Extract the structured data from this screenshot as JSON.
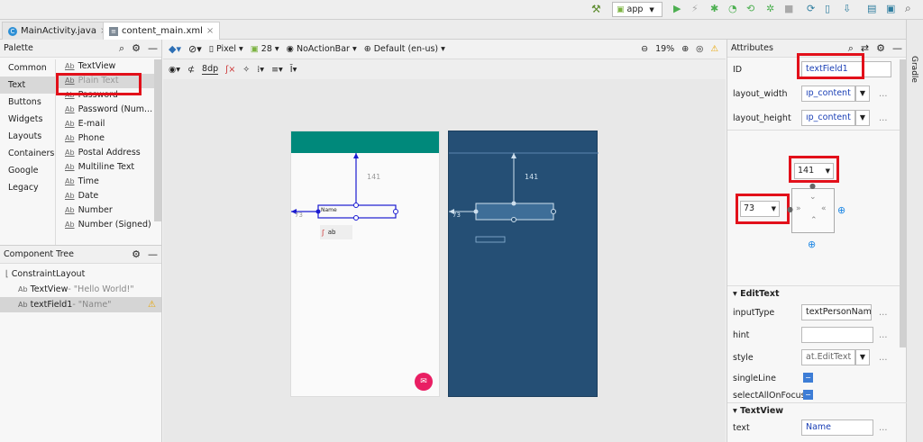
{
  "toolbar": {
    "run_config": "app"
  },
  "tabs": [
    {
      "label": "MainActivity.java",
      "icon": "java-class-icon"
    },
    {
      "label": "content_main.xml",
      "icon": "layout-file-icon"
    }
  ],
  "gradle_label": "Gradle",
  "palette": {
    "title": "Palette",
    "categories": [
      "Common",
      "Text",
      "Buttons",
      "Widgets",
      "Layouts",
      "Containers",
      "Google",
      "Legacy"
    ],
    "selected_category": "Text",
    "items": [
      "TextView",
      "Plain Text",
      "Password",
      "Password (Num...",
      "E-mail",
      "Phone",
      "Postal Address",
      "Multiline Text",
      "Time",
      "Date",
      "Number",
      "Number (Signed)"
    ]
  },
  "component_tree": {
    "title": "Component Tree",
    "root": "ConstraintLayout",
    "children": [
      {
        "name": "TextView",
        "detail": "- \"Hello World!\""
      },
      {
        "name": "textField1",
        "detail": "- \"Name\""
      }
    ]
  },
  "editor_toolbar": {
    "device": "Pixel",
    "api": "28",
    "theme": "NoActionBar",
    "locale": "Default (en-us)",
    "zoom": "19%",
    "margin": "8dp"
  },
  "design": {
    "top_margin": "141",
    "left_margin": "73",
    "field_text": "Name"
  },
  "attributes": {
    "title": "Attributes",
    "id_label": "ID",
    "id_value": "textField1",
    "layout_width_label": "layout_width",
    "layout_width_value": "ıp_content",
    "layout_height_label": "layout_height",
    "layout_height_value": "ıp_content",
    "top_margin": "141",
    "left_margin": "73",
    "edittext_section": "EditText",
    "input_type_label": "inputType",
    "input_type_value": "textPersonName",
    "hint_label": "hint",
    "hint_value": "",
    "style_label": "style",
    "style_value": "at.EditText",
    "single_line_label": "singleLine",
    "select_all_label": "selectAllOnFocus",
    "textview_section": "TextView",
    "text_label": "text",
    "text_value": "Name"
  },
  "colors": {
    "teal": "#00897b",
    "blueprint": "#254f75",
    "highlight": "#e2101a",
    "accent_pink": "#e91e63"
  }
}
